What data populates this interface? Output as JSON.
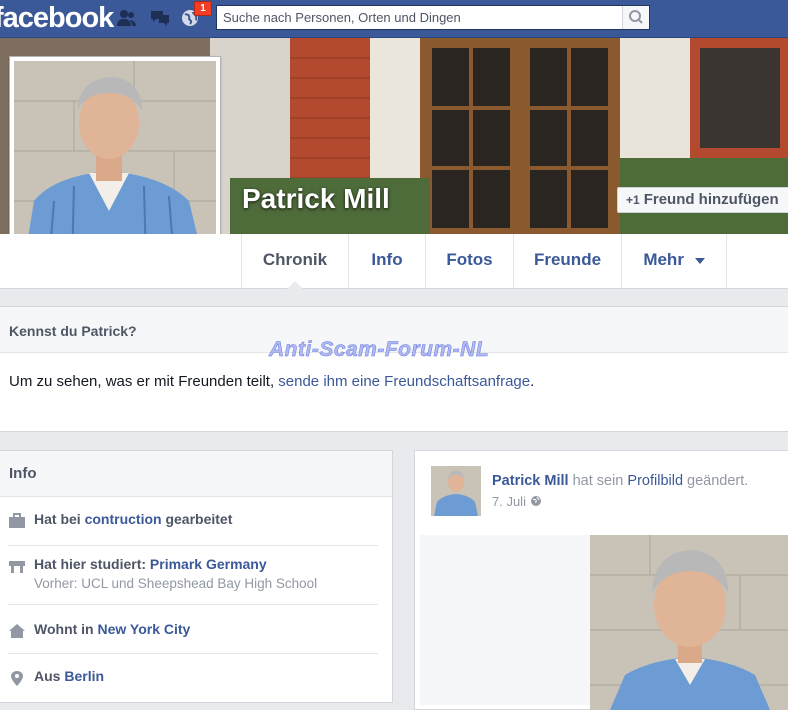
{
  "topbar": {
    "logo": "facebook",
    "notification_count": "1",
    "search_placeholder": "Suche nach Personen, Orten und Dingen",
    "jewel_icons": [
      "friend-requests-icon",
      "messages-icon",
      "notifications-globe-icon"
    ]
  },
  "profile": {
    "name": "Patrick Mill",
    "add_friend_label": "Freund hinzufügen"
  },
  "tabs": [
    {
      "label": "Chronik",
      "active": true
    },
    {
      "label": "Info",
      "active": false
    },
    {
      "label": "Fotos",
      "active": false
    },
    {
      "label": "Freunde",
      "active": false
    },
    {
      "label": "Mehr",
      "active": false
    }
  ],
  "know_box": {
    "heading": "Kennst du Patrick?",
    "text_before": "Um zu sehen, was er mit Freunden teilt, ",
    "link": "sende ihm eine Freundschaftsanfrage",
    "text_after": "."
  },
  "watermark": "Anti-Scam-Forum-NL",
  "info": {
    "heading": "Info",
    "work_prefix": "Hat bei ",
    "work_link": "contruction",
    "work_suffix": " gearbeitet",
    "study_prefix": "Hat hier studiert: ",
    "study_link": "Primark Germany",
    "study_sub": "Vorher: UCL und Sheepshead Bay High School",
    "home_prefix": "Wohnt in ",
    "home_link": "New York City",
    "from_prefix": "Aus ",
    "from_link": "Berlin"
  },
  "post": {
    "author": "Patrick Mill",
    "action_prefix": " hat sein ",
    "action_link": "Profilbild",
    "action_suffix": " geändert.",
    "date": "7. Juli"
  },
  "colors": {
    "brand": "#3b5998",
    "background": "#e9eaed",
    "badge": "#f03d25"
  }
}
